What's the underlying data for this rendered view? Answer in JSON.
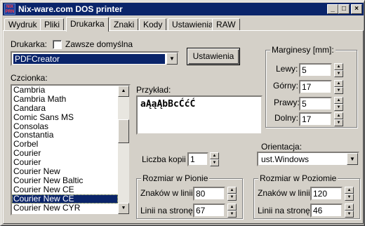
{
  "window": {
    "title": "Nix-ware.com DOS printer",
    "icon_text": "NIX PRN",
    "controls": {
      "minimize": "_",
      "maximize": "□",
      "close": "×"
    }
  },
  "tabs": [
    "Wydruk",
    "Pliki",
    "Drukarka",
    "Znaki",
    "Kody",
    "Ustawienia",
    "RAW"
  ],
  "printer": {
    "label": "Drukarka:",
    "default_checkbox_label": "Zawsze domyślna",
    "default_checked": false,
    "selected": "PDFCreator",
    "settings_button": "Ustawienia"
  },
  "font": {
    "label": "Czcionka:",
    "items": [
      "Cambria",
      "Cambria Math",
      "Candara",
      "Comic Sans MS",
      "Consolas",
      "Constantia",
      "Corbel",
      "Courier",
      "Courier",
      "Courier New",
      "Courier New Baltic",
      "Courier New CE",
      "Courier New CE",
      "Courier New CYR"
    ],
    "selected_index": 12
  },
  "preview": {
    "label": "Przykład:",
    "text": "aĄąĄbBcĆćĆ"
  },
  "margins": {
    "title": "Marginesy [mm]:",
    "left_label": "Lewy:",
    "left": "5",
    "top_label": "Górny:",
    "top": "17",
    "right_label": "Prawy:",
    "right": "5",
    "bottom_label": "Dolny:",
    "bottom": "17"
  },
  "copies": {
    "label": "Liczba kopii",
    "value": "1"
  },
  "orientation": {
    "label": "Orientacja:",
    "selected": "ust.Windows"
  },
  "portrait": {
    "title": "Rozmiar w Pionie",
    "chars_label": "Znaków w linii:",
    "chars": "80",
    "lines_label": "Linii na stronę:",
    "lines": "67"
  },
  "landscape": {
    "title": "Rozmiar w Poziomie",
    "chars_label": "Znaków w linii:",
    "chars": "120",
    "lines_label": "Linii na stronę:",
    "lines": "46"
  },
  "icons": {
    "combo_arrow": "▼",
    "scroll_up": "▲",
    "scroll_down": "▼",
    "spin_up": "▲",
    "spin_down": "▼"
  }
}
